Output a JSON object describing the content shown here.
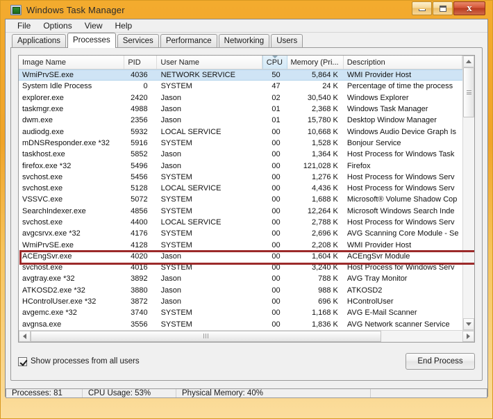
{
  "window": {
    "title": "Windows Task Manager",
    "icon": "task-manager-icon",
    "buttons": {
      "minimize": "–",
      "maximize": "□",
      "close": "✕"
    }
  },
  "menu": {
    "items": [
      "File",
      "Options",
      "View",
      "Help"
    ]
  },
  "tabs": {
    "items": [
      "Applications",
      "Processes",
      "Services",
      "Performance",
      "Networking",
      "Users"
    ],
    "active": "Processes"
  },
  "table": {
    "columns": [
      "Image Name",
      "PID",
      "User Name",
      "CPU",
      "Memory (Pri...",
      "Description"
    ],
    "sorted_column": "CPU",
    "sort_direction": "descending",
    "selected_row_index": 0,
    "highlighted_row_index": 16,
    "rows": [
      {
        "name": "WmiPrvSE.exe",
        "pid": "4036",
        "user": "NETWORK SERVICE",
        "cpu": "50",
        "mem": "5,864 K",
        "desc": "WMI Provider Host"
      },
      {
        "name": "System Idle Process",
        "pid": "0",
        "user": "SYSTEM",
        "cpu": "47",
        "mem": "24 K",
        "desc": "Percentage of time the process"
      },
      {
        "name": "explorer.exe",
        "pid": "2420",
        "user": "Jason",
        "cpu": "02",
        "mem": "30,540 K",
        "desc": "Windows Explorer"
      },
      {
        "name": "taskmgr.exe",
        "pid": "4988",
        "user": "Jason",
        "cpu": "01",
        "mem": "2,368 K",
        "desc": "Windows Task Manager"
      },
      {
        "name": "dwm.exe",
        "pid": "2356",
        "user": "Jason",
        "cpu": "01",
        "mem": "15,780 K",
        "desc": "Desktop Window Manager"
      },
      {
        "name": "audiodg.exe",
        "pid": "5932",
        "user": "LOCAL SERVICE",
        "cpu": "00",
        "mem": "10,668 K",
        "desc": "Windows Audio Device Graph Is"
      },
      {
        "name": "mDNSResponder.exe *32",
        "pid": "5916",
        "user": "SYSTEM",
        "cpu": "00",
        "mem": "1,528 K",
        "desc": "Bonjour Service"
      },
      {
        "name": "taskhost.exe",
        "pid": "5852",
        "user": "Jason",
        "cpu": "00",
        "mem": "1,364 K",
        "desc": "Host Process for Windows Task"
      },
      {
        "name": "firefox.exe *32",
        "pid": "5496",
        "user": "Jason",
        "cpu": "00",
        "mem": "121,028 K",
        "desc": "Firefox"
      },
      {
        "name": "svchost.exe",
        "pid": "5456",
        "user": "SYSTEM",
        "cpu": "00",
        "mem": "1,276 K",
        "desc": "Host Process for Windows Serv"
      },
      {
        "name": "svchost.exe",
        "pid": "5128",
        "user": "LOCAL SERVICE",
        "cpu": "00",
        "mem": "4,436 K",
        "desc": "Host Process for Windows Serv"
      },
      {
        "name": "VSSVC.exe",
        "pid": "5072",
        "user": "SYSTEM",
        "cpu": "00",
        "mem": "1,688 K",
        "desc": "Microsoft® Volume Shadow Cop"
      },
      {
        "name": "SearchIndexer.exe",
        "pid": "4856",
        "user": "SYSTEM",
        "cpu": "00",
        "mem": "12,264 K",
        "desc": "Microsoft Windows Search Inde"
      },
      {
        "name": "svchost.exe",
        "pid": "4400",
        "user": "LOCAL SERVICE",
        "cpu": "00",
        "mem": "2,788 K",
        "desc": "Host Process for Windows Serv"
      },
      {
        "name": "avgcsrvx.exe *32",
        "pid": "4176",
        "user": "SYSTEM",
        "cpu": "00",
        "mem": "2,696 K",
        "desc": "AVG Scanning Core Module - Se"
      },
      {
        "name": "WmiPrvSE.exe",
        "pid": "4128",
        "user": "SYSTEM",
        "cpu": "00",
        "mem": "2,208 K",
        "desc": "WMI Provider Host"
      },
      {
        "name": "ACEngSvr.exe",
        "pid": "4020",
        "user": "Jason",
        "cpu": "00",
        "mem": "1,604 K",
        "desc": "ACEngSvr Module"
      },
      {
        "name": "svchost.exe",
        "pid": "4016",
        "user": "SYSTEM",
        "cpu": "00",
        "mem": "3,240 K",
        "desc": "Host Process for Windows Serv"
      },
      {
        "name": "avgtray.exe *32",
        "pid": "3892",
        "user": "Jason",
        "cpu": "00",
        "mem": "788 K",
        "desc": "AVG Tray Monitor"
      },
      {
        "name": "ATKOSD2.exe *32",
        "pid": "3880",
        "user": "Jason",
        "cpu": "00",
        "mem": "988 K",
        "desc": "ATKOSD2"
      },
      {
        "name": "HControlUser.exe *32",
        "pid": "3872",
        "user": "Jason",
        "cpu": "00",
        "mem": "696 K",
        "desc": "HControlUser"
      },
      {
        "name": "avgemc.exe *32",
        "pid": "3740",
        "user": "SYSTEM",
        "cpu": "00",
        "mem": "1,168 K",
        "desc": "AVG E-Mail Scanner"
      },
      {
        "name": "avgnsa.exe",
        "pid": "3556",
        "user": "SYSTEM",
        "cpu": "00",
        "mem": "1,836 K",
        "desc": "AVG Network scanner Service"
      }
    ]
  },
  "controls": {
    "show_all_users_label": "Show processes from all users",
    "show_all_users_checked": true,
    "end_process_label": "End Process"
  },
  "statusbar": {
    "processes": "Processes: 81",
    "cpu_usage": "CPU Usage: 53%",
    "physical_memory": "Physical Memory: 40%"
  },
  "colors": {
    "frame": "#f0a42a",
    "selection": "#cfe4f5",
    "highlight_box": "#9c2a2a",
    "sorted_header": "#d3e8f6"
  }
}
